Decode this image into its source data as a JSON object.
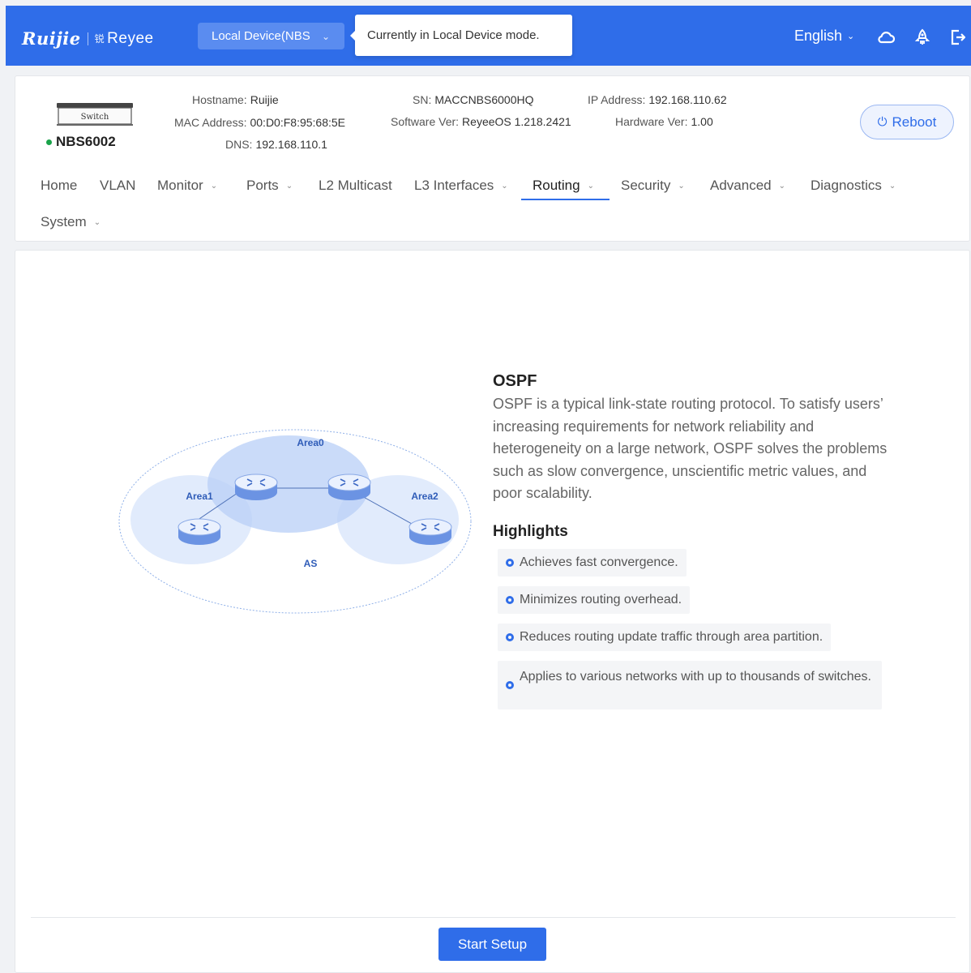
{
  "header": {
    "brand_ruijie": "Ruijie",
    "brand_reyee": "Reyee",
    "brand_reyee_mark": "锐",
    "device_select": "Local Device(NBS",
    "tooltip": "Currently in Local Device mode.",
    "language": "English",
    "icons": [
      "cloud-icon",
      "rocket-icon",
      "logout-icon"
    ]
  },
  "device": {
    "model": "NBS6002",
    "image_label": "Switch",
    "status_color": "#1aa34a",
    "hostname_label": "Hostname:",
    "hostname": "Ruijie",
    "mac_label": "MAC Address:",
    "mac": "00:D0:F8:95:68:5E",
    "dns_label": "DNS:",
    "dns": "192.168.110.1",
    "sn_label": "SN:",
    "sn": "MACCNBS6000HQ",
    "software_label": "Software Ver:",
    "software": "ReyeeOS 1.218.2421",
    "ip_label": "IP Address:",
    "ip": "192.168.110.62",
    "hardware_label": "Hardware Ver:",
    "hardware": "1.00",
    "reboot_label": "Reboot"
  },
  "nav": {
    "items": [
      {
        "label": "Home"
      },
      {
        "label": "VLAN"
      },
      {
        "label": "Monitor"
      },
      {
        "label": "Ports"
      },
      {
        "label": "L2 Multicast"
      },
      {
        "label": "L3 Interfaces"
      },
      {
        "label": "Routing"
      },
      {
        "label": "Security"
      },
      {
        "label": "Advanced"
      },
      {
        "label": "Diagnostics"
      },
      {
        "label": "System"
      }
    ],
    "active": "Routing"
  },
  "main": {
    "diagram": {
      "area0": "Area0",
      "area1": "Area1",
      "area2": "Area2",
      "as": "AS"
    },
    "title": "OSPF",
    "description": "OSPF is a typical link-state routing protocol. To satisfy users’   increasing requirements for network reliability and heterogeneity on a large network, OSPF solves the problems such as slow convergence, unscientific metric values, and poor scalability.",
    "highlights_title": "Highlights",
    "highlights": [
      "Achieves fast convergence.",
      "Minimizes routing overhead.",
      "Reduces routing update traffic through area partition.",
      "Applies to various networks with up to thousands of switches."
    ],
    "start_button": "Start Setup"
  },
  "colors": {
    "accent": "#2f6de9",
    "status_online": "#1aa34a"
  }
}
